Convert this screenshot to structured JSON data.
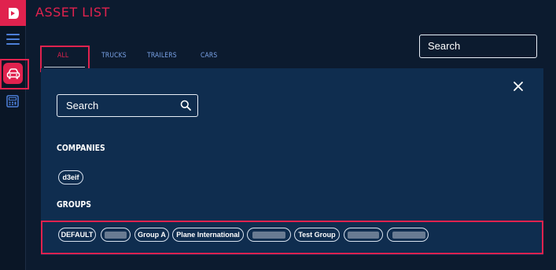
{
  "app": {
    "title": "ASSET LIST",
    "accent_color": "#e0224e",
    "link_color": "#7aa2e6"
  },
  "rail": {
    "logo_icon": "brand-logo-icon",
    "items": [
      {
        "icon": "hamburger-menu-icon"
      },
      {
        "icon": "car-icon",
        "active": true
      },
      {
        "icon": "calculator-icon"
      }
    ]
  },
  "header": {
    "search_placeholder": "Search"
  },
  "tabs": [
    {
      "label": "ALL",
      "active": true
    },
    {
      "label": "TRUCKS"
    },
    {
      "label": "TRAILERS"
    },
    {
      "label": "CARS"
    }
  ],
  "panel": {
    "search_placeholder": "Search",
    "companies_heading": "COMPANIES",
    "companies": [
      "d3eif"
    ],
    "groups_heading": "GROUPS",
    "groups": [
      {
        "label": "DEFAULT"
      },
      {
        "label": "",
        "redacted": true
      },
      {
        "label": "Group A"
      },
      {
        "label": "Plane International"
      },
      {
        "label": "",
        "redacted": true
      },
      {
        "label": "Test Group"
      },
      {
        "label": "",
        "redacted": true
      },
      {
        "label": "",
        "redacted": true
      }
    ]
  }
}
